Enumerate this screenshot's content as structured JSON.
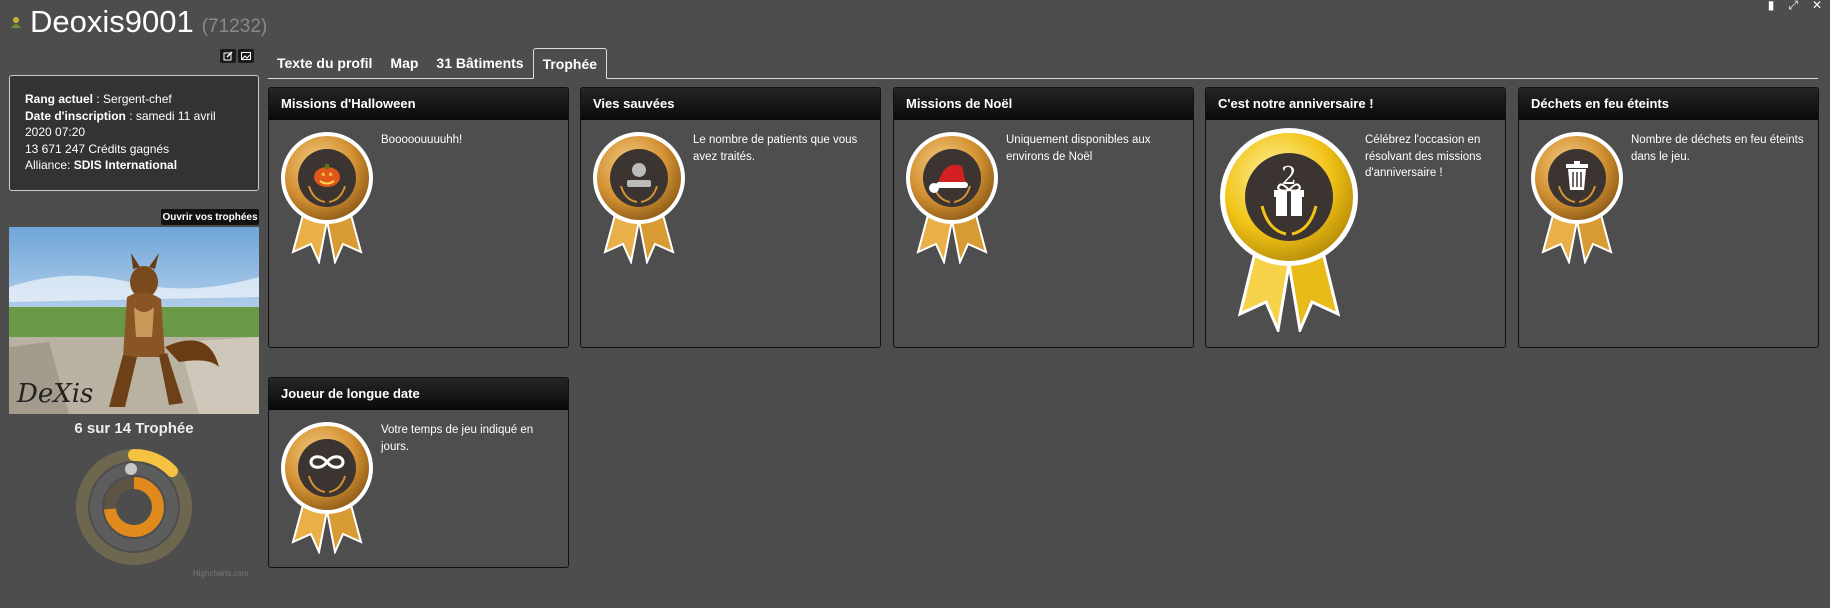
{
  "window": {
    "controls": [
      "clipboard-icon",
      "fullscreen-icon",
      "close-icon"
    ]
  },
  "header": {
    "username": "Deoxis9001",
    "user_id": "(71232)"
  },
  "profile": {
    "rank_label": "Rang actuel",
    "rank_value": " : Sergent-chef",
    "joined_label": "Date d'inscription",
    "joined_value": " : samedi 11 avril 2020 07:20",
    "credits": "13 671 247 Crédits gagnés",
    "alliance_label": "Alliance: ",
    "alliance_value": "SDIS International",
    "open_trophies": "Ouvrir vos trophées"
  },
  "trophy_summary": {
    "label": "6 sur 14 Trophée",
    "earned": 6,
    "total": 14,
    "credits_text": "Highcharts.com"
  },
  "tabs": [
    {
      "label": "Texte du profil"
    },
    {
      "label": "Map"
    },
    {
      "label": "31 Bâtiments"
    },
    {
      "label": "Trophée"
    }
  ],
  "active_tab": "Trophée",
  "trophies": [
    {
      "title": "Missions d'Halloween",
      "desc": "Booooouuuuhh!",
      "icon": "pumpkin-icon",
      "tier": "bronze"
    },
    {
      "title": "Vies sauvées",
      "desc": "Le nombre de patients que vous avez traités.",
      "icon": "person-icon",
      "tier": "bronze"
    },
    {
      "title": "Missions de Noël",
      "desc": "Uniquement disponibles aux environs de Noël",
      "icon": "santa-hat-icon",
      "tier": "bronze"
    },
    {
      "title": "C'est notre anniversaire !",
      "desc": "Célébrez l'occasion en résolvant des missions d'anniversaire !",
      "icon": "gift-icon",
      "tier": "gold",
      "badge_number": "2"
    },
    {
      "title": "Déchets en feu éteints",
      "desc": "Nombre de déchets en feu éteints dans le jeu.",
      "icon": "trash-can-icon",
      "tier": "bronze"
    },
    {
      "title": "Joueur de longue date",
      "desc": "Votre temps de jeu indiqué en jours.",
      "icon": "infinity-icon",
      "tier": "bronze"
    }
  ],
  "colors": {
    "background": "#4d4d4d",
    "panel_header": "#0d0d0d",
    "bronze": "#c98a2a",
    "gold": "#f2c418",
    "donut_orange": "#e08a1e",
    "donut_yellow": "#f5c242"
  }
}
